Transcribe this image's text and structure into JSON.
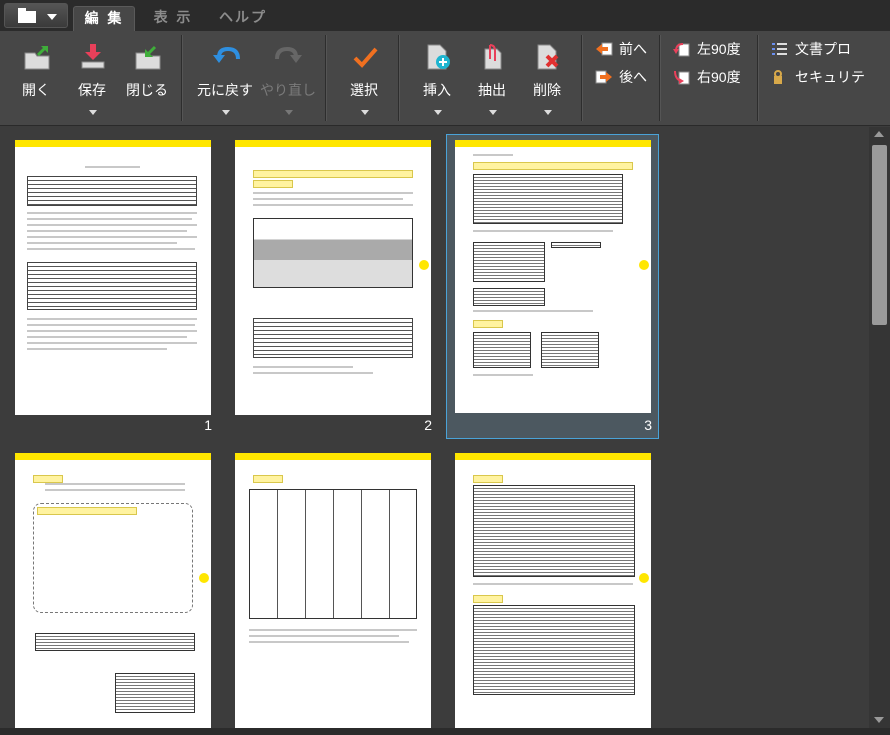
{
  "tabs": [
    {
      "label": "編 集"
    },
    {
      "label": "表 示"
    },
    {
      "label": "ヘルプ"
    }
  ],
  "ribbon": {
    "open": "開く",
    "save": "保存",
    "close": "閉じる",
    "undo": "元に戻す",
    "redo": "やり直し",
    "select": "選択",
    "insert": "挿入",
    "extract": "抽出",
    "delete": "削除",
    "prev": "前へ",
    "next": "後へ",
    "rotate_left": "左90度",
    "rotate_right": "右90度",
    "doc_props": "文書プロ",
    "security": "セキュリテ"
  },
  "pages": [
    {
      "num": "1"
    },
    {
      "num": "2"
    },
    {
      "num": "3"
    }
  ],
  "colors": {
    "accent": "#ffe600",
    "selection": "#4aa3d8",
    "arrow_blue": "#2e8fe0",
    "arrow_green": "#3fae3a",
    "check_orange": "#f07020",
    "delete_red": "#e03030"
  }
}
